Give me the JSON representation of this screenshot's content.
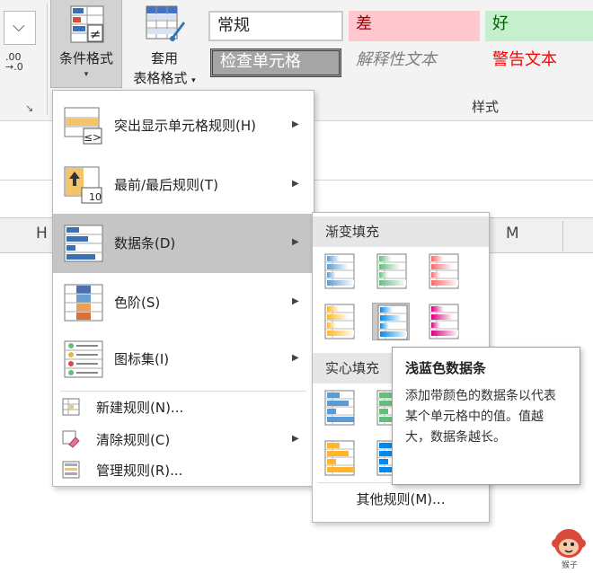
{
  "ribbon": {
    "decimal_label": ".00\n→.0",
    "conditional_format": {
      "label": "条件格式",
      "arrow": "▾"
    },
    "table_format": {
      "line1": "套用",
      "line2": "表格格式",
      "arrow": "▾"
    },
    "styles": {
      "normal": "常规",
      "bad": "差",
      "good": "好",
      "check_cell": "检查单元格",
      "explanatory": "解释性文本",
      "warning": "警告文本",
      "group_label": "样式"
    }
  },
  "grid": {
    "columns": [
      "H",
      "M"
    ]
  },
  "menu": {
    "items": [
      {
        "label": "突出显示单元格规则(H)",
        "has_submenu": true
      },
      {
        "label": "最前/最后规则(T)",
        "has_submenu": true
      },
      {
        "label": "数据条(D)",
        "has_submenu": true,
        "highlighted": true
      },
      {
        "label": "色阶(S)",
        "has_submenu": true
      },
      {
        "label": "图标集(I)",
        "has_submenu": true
      },
      {
        "label": "新建规则(N)...",
        "has_submenu": false
      },
      {
        "label": "清除规则(C)",
        "has_submenu": true
      },
      {
        "label": "管理规则(R)...",
        "has_submenu": false
      }
    ],
    "arrow": "▶",
    "top10_label": "10"
  },
  "submenu": {
    "gradient_header": "渐变填充",
    "solid_header": "实心填充",
    "more_rules": "其他规则(M)...",
    "gradient_colors": [
      "#5b9bd5",
      "#63be7b",
      "#f8696b",
      "#ffb628",
      "#008aef",
      "#d6007b"
    ],
    "solid_colors": [
      "#5b9bd5",
      "#63be7b",
      "#ffb628",
      "#008aef"
    ],
    "selected": "light-blue-gradient"
  },
  "tooltip": {
    "title": "浅蓝色数据条",
    "body": "添加带颜色的数据条以代表某个单元格中的值。值越大，数据条越长。"
  },
  "watermark": {
    "text": "猴子"
  }
}
